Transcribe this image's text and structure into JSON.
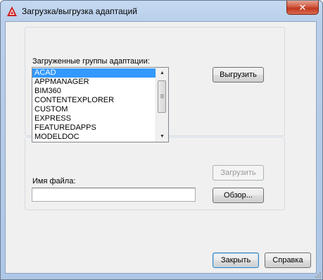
{
  "window": {
    "title": "Загрузка/выгрузка адаптаций",
    "close_glyph": "✕"
  },
  "groups": {
    "label": "Загруженные группы адаптации:",
    "items": [
      "ACAD",
      "APPMANAGER",
      "BIM360",
      "CONTENTEXPLORER",
      "CUSTOM",
      "EXPRESS",
      "FEATUREDAPPS",
      "MODELDOC"
    ],
    "selected": "ACAD",
    "unload_button": "Выгрузить"
  },
  "file": {
    "label": "Имя файла:",
    "value": "",
    "load_button": "Загрузить",
    "browse_button": "Обзор..."
  },
  "footer": {
    "close_button": "Закрыть",
    "help_button": "Справка"
  },
  "colors": {
    "selection": "#3399ff",
    "close_button": "#c0371f",
    "app_icon": "#cc1f1f"
  }
}
